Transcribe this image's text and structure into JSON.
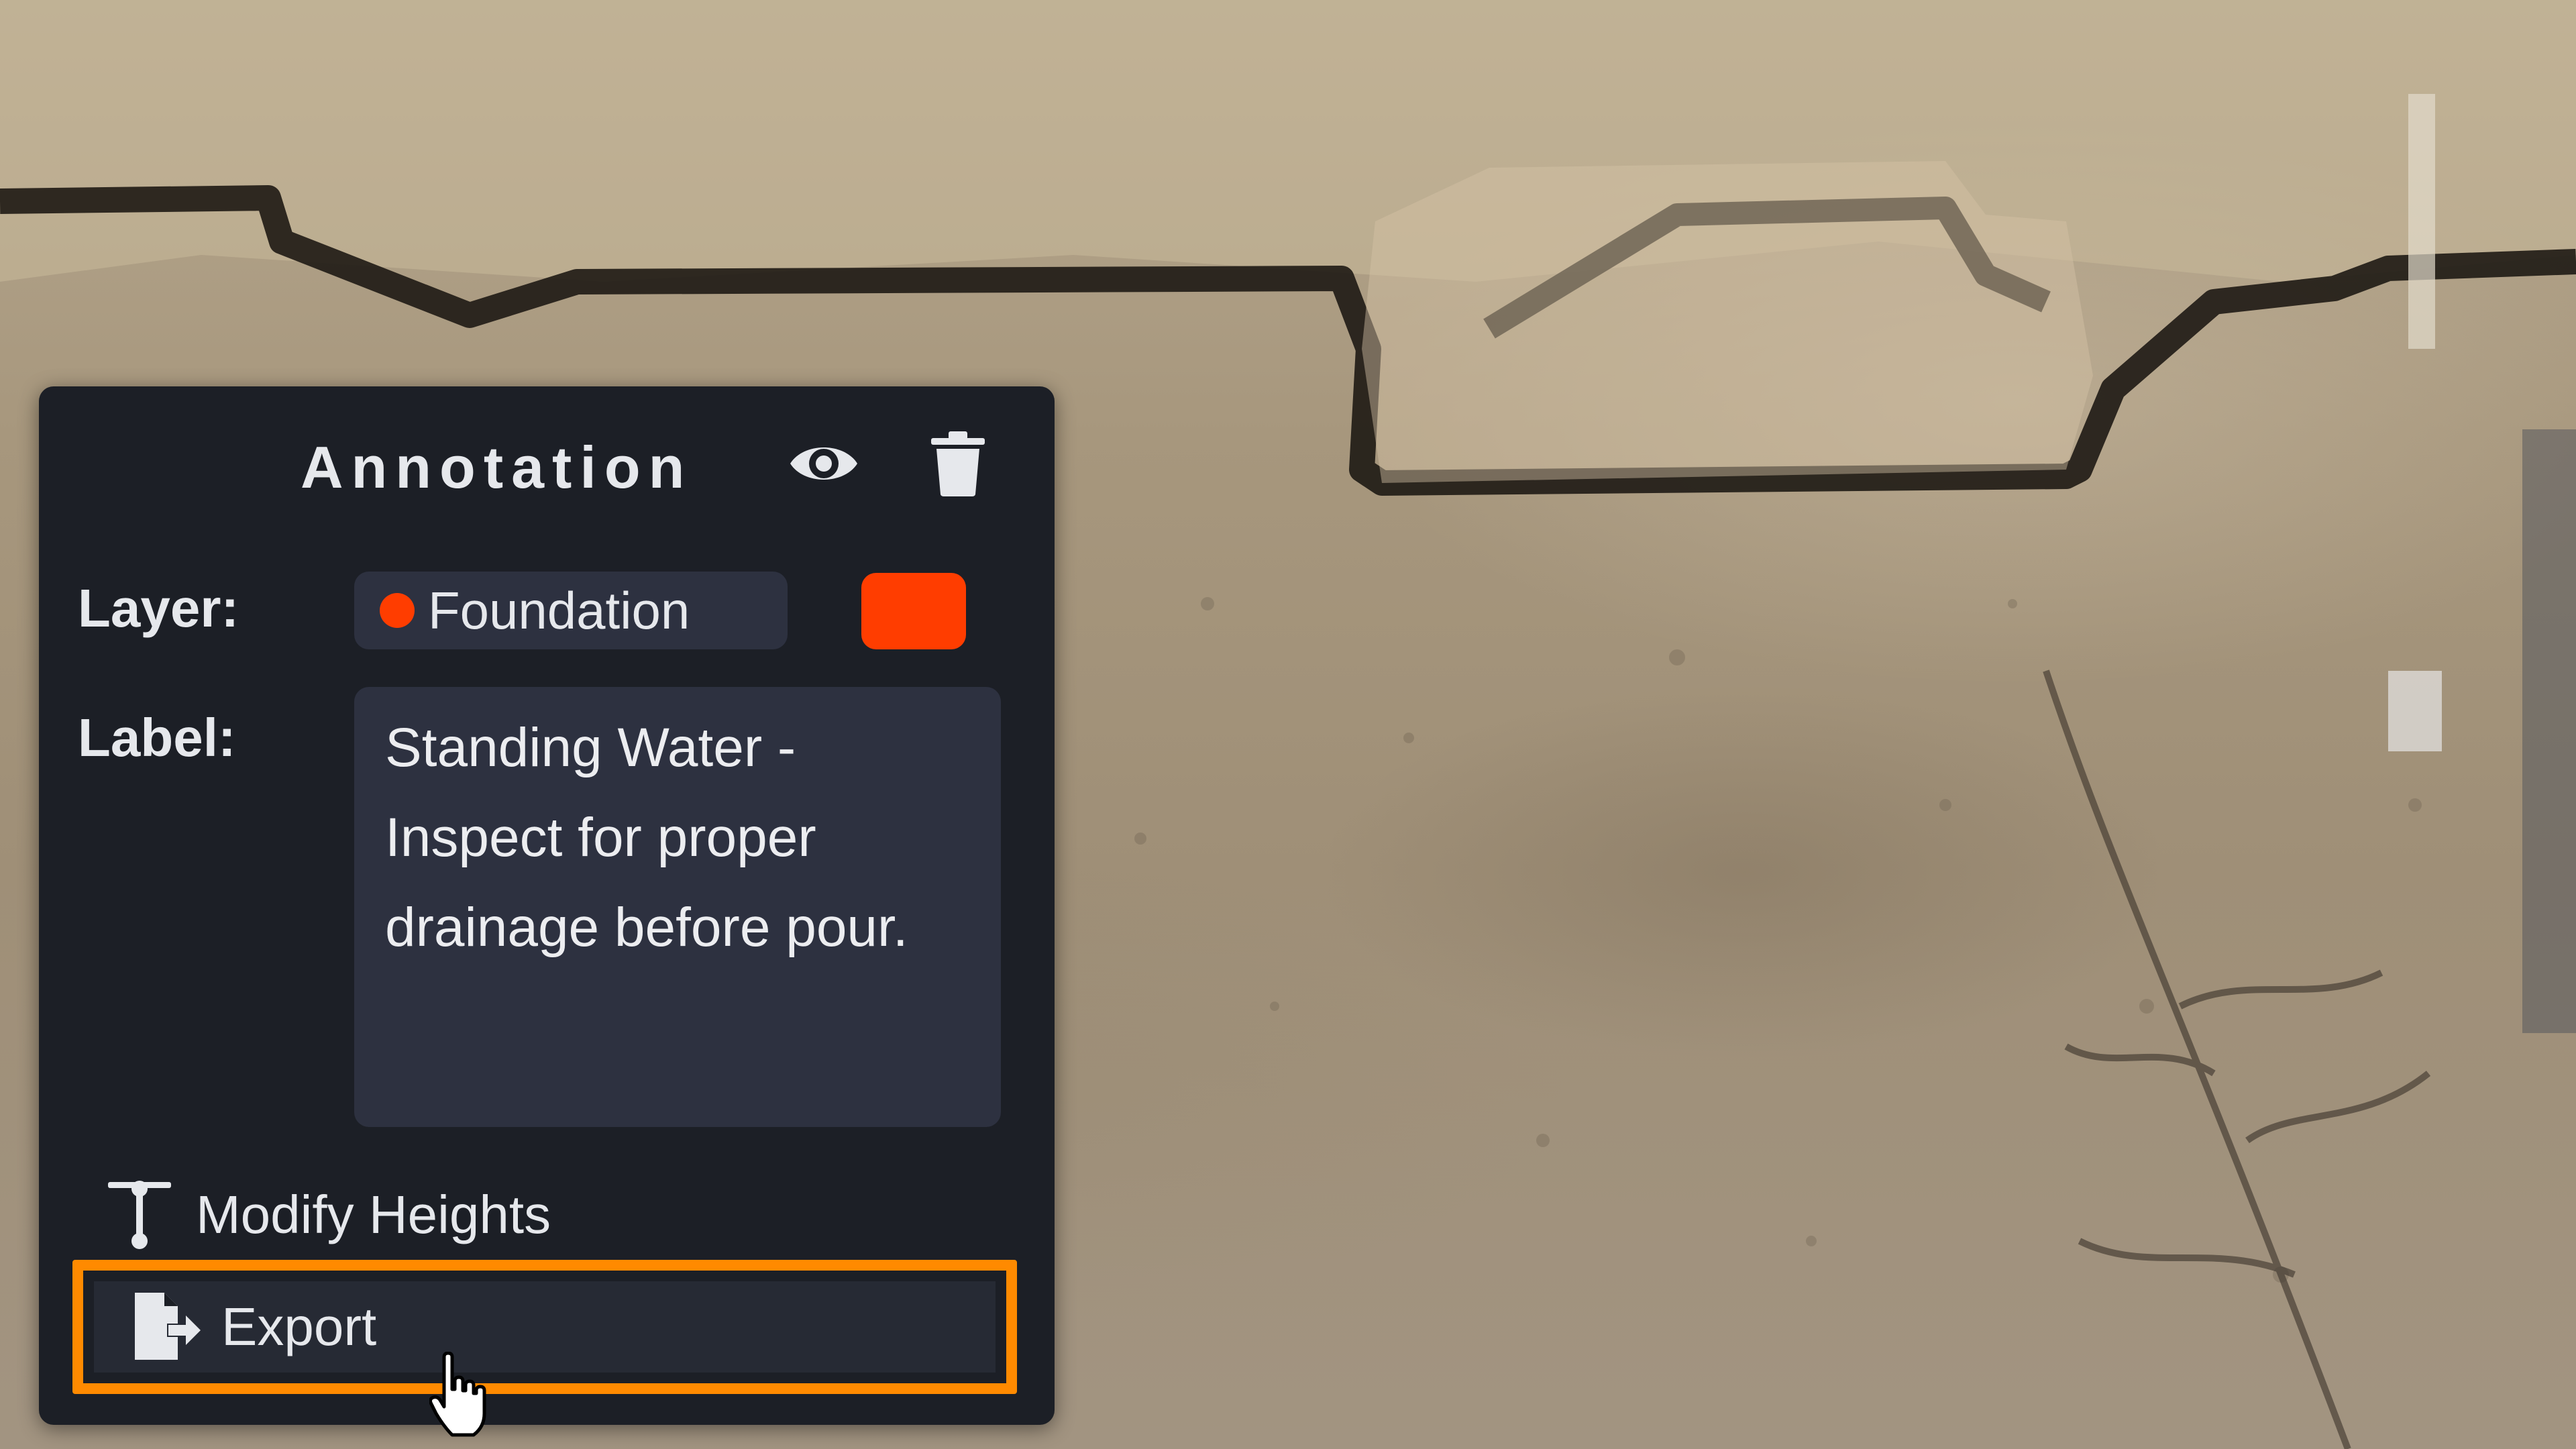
{
  "panel": {
    "title": "Annotation",
    "visibility_icon": "eye-icon",
    "delete_icon": "trash-icon",
    "layer": {
      "label": "Layer:",
      "selected": "Foundation",
      "color": "#ff3d00"
    },
    "text_label": {
      "label": "Label:",
      "value": "Standing Water - Inspect for proper drainage before pour."
    },
    "actions": [
      {
        "label": "Modify Heights",
        "icon": "height-adjust-icon"
      },
      {
        "label": "Export",
        "icon": "file-export-icon",
        "highlighted": true,
        "highlight_color": "#ff8a00"
      }
    ]
  }
}
